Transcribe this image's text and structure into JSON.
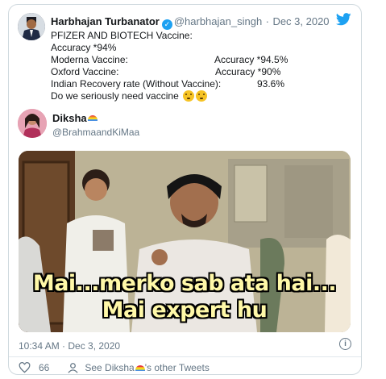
{
  "tweet": {
    "author_name": "Harbhajan Turbanator",
    "author_handle": "@harbhajan_singh",
    "separator": "·",
    "date": "Dec 3, 2020",
    "lines": [
      {
        "left": "PFIZER AND BIOTECH Vaccine:",
        "right": ""
      },
      {
        "left": "Accuracy *94%",
        "right": ""
      },
      {
        "left": "Moderna Vaccine:",
        "right": "Accuracy *94.5%"
      },
      {
        "left": "Oxford Vaccine:",
        "right": "Accuracy *90%"
      },
      {
        "left": "Indian Recovery rate (Without Vaccine):",
        "right": "93.6%"
      },
      {
        "left": "Do we seriously need vaccine",
        "right": ""
      }
    ],
    "emoji": "thinking-face-emoji"
  },
  "reply": {
    "name": "Diksha",
    "handle": "@BrahmaandKiMaa",
    "meme_line1": "Mai...merko sab ata hai...",
    "meme_line2": "Mai expert hu",
    "timestamp": "10:34 AM · Dec 3, 2020",
    "like_count": "66",
    "see_more_prefix": "See Diksha",
    "see_more_suffix": "'s other Tweets",
    "info_glyph": "i"
  },
  "colors": {
    "twitter_blue": "#1da1f2",
    "muted": "#657786",
    "meme_text": "#fff8a8"
  }
}
